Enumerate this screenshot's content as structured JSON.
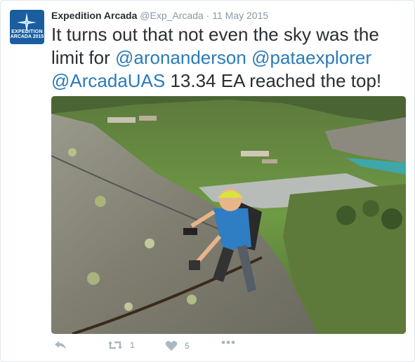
{
  "account": {
    "avatar_line1": "EXPEDITION",
    "avatar_line2": "ARCADA 2015",
    "name": "Expedition Arcada",
    "handle": "@Exp_Arcada",
    "separator": " · ",
    "date": "11 May 2015"
  },
  "tweet": {
    "text_before": "It turns out that not even the sky was the limit for ",
    "mention1": "@aronanderson",
    "space1": " ",
    "mention2": "@pataexplorer",
    "space2": " ",
    "mention3": "@ArcadaUAS",
    "text_after": " 13.34 EA reached the top!"
  },
  "actions": {
    "retweet_count": "1",
    "like_count": "5"
  },
  "colors": {
    "link": "#2b7bb9",
    "meta": "#8899a6",
    "action": "#aab8c2",
    "avatar_bg": "#1b5ea0"
  }
}
